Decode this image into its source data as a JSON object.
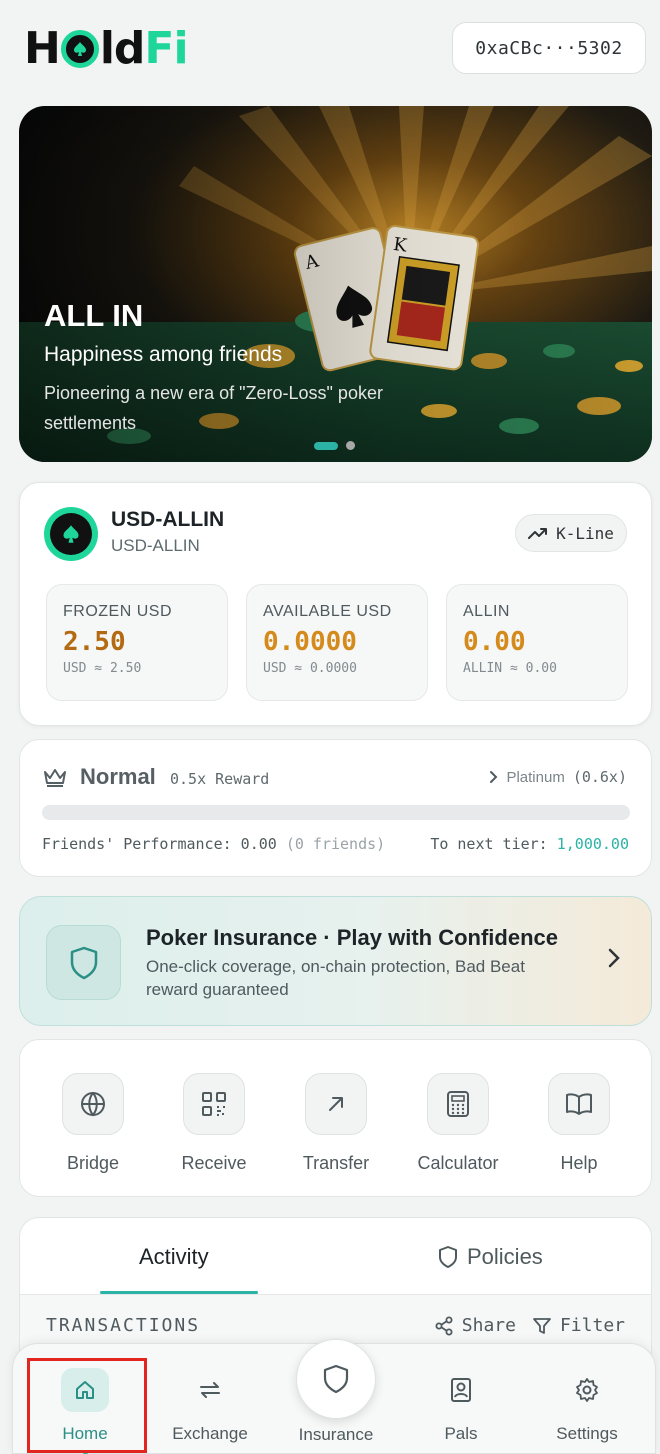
{
  "header": {
    "logo_text": "HoldFi",
    "wallet_address": "0xaCBc···5302"
  },
  "banner": {
    "title": "ALL IN",
    "subtitle": "Happiness among friends",
    "description": "Pioneering a new era of \"Zero-Loss\" poker settlements",
    "slide_count": 2,
    "active_slide": 1
  },
  "asset": {
    "name": "USD-ALLIN",
    "subtitle": "USD-ALLIN",
    "kline_label": "K-Line",
    "stats": [
      {
        "label": "FROZEN USD",
        "value": "2.50",
        "equiv": "USD ≈ 2.50"
      },
      {
        "label": "AVAILABLE USD",
        "value": "0.0000",
        "equiv": "USD ≈ 0.0000"
      },
      {
        "label": "ALLIN",
        "value": "0.00",
        "equiv": "ALLIN ≈ 0.00"
      }
    ]
  },
  "tier": {
    "name": "Normal",
    "reward": "0.5x Reward",
    "next_name": "Platinum",
    "next_reward": "(0.6x)",
    "progress": 0,
    "performance_label": "Friends' Performance: 0.00",
    "friends_count": "(0 friends)",
    "next_tier_label": "To next tier:",
    "next_tier_value": "1,000.00"
  },
  "promo": {
    "title": "Poker Insurance · Play with Confidence",
    "description": "One-click coverage, on-chain protection, Bad Beat reward guaranteed"
  },
  "actions": [
    {
      "label": "Bridge",
      "icon": "globe-icon"
    },
    {
      "label": "Receive",
      "icon": "qr-code-icon"
    },
    {
      "label": "Transfer",
      "icon": "arrow-up-right-icon"
    },
    {
      "label": "Calculator",
      "icon": "calculator-icon"
    },
    {
      "label": "Help",
      "icon": "book-icon"
    }
  ],
  "activity": {
    "tabs": [
      "Activity",
      "Policies"
    ],
    "active_tab": "Activity",
    "section_title": "TRANSACTIONS",
    "share_label": "Share",
    "filter_label": "Filter"
  },
  "nav": {
    "items": [
      {
        "label": "Home",
        "icon": "home-icon",
        "active": true
      },
      {
        "label": "Exchange",
        "icon": "exchange-icon",
        "active": false
      },
      {
        "label": "Insurance",
        "icon": "shield-icon",
        "active": false
      },
      {
        "label": "Pals",
        "icon": "contact-icon",
        "active": false
      },
      {
        "label": "Settings",
        "icon": "gear-icon",
        "active": false
      }
    ]
  },
  "colors": {
    "accent": "#2bb3a6",
    "brand_green": "#1fd69a",
    "value_orange": "#d58a1c",
    "highlight_red": "#e2261f"
  }
}
